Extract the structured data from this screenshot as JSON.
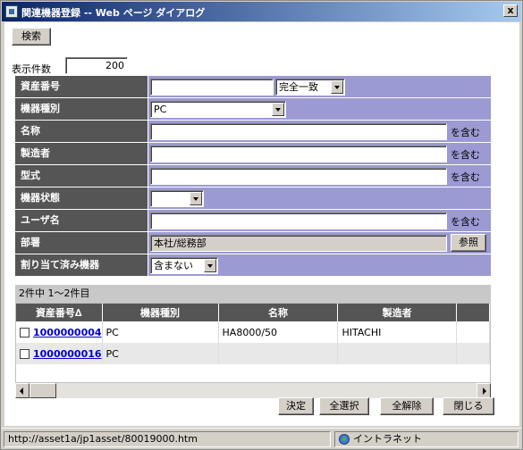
{
  "window": {
    "title": "関連機器登録 -- Web ページ ダイアログ",
    "close": "x"
  },
  "search_button": "検索",
  "display_count": {
    "label": "表示件数",
    "value": "200"
  },
  "fields": {
    "asset_no": {
      "label": "資産番号",
      "value": "",
      "match": "完全一致"
    },
    "device_type": {
      "label": "機器種別",
      "value": "PC"
    },
    "name": {
      "label": "名称",
      "value": "",
      "suffix": "を含む"
    },
    "maker": {
      "label": "製造者",
      "value": "",
      "suffix": "を含む"
    },
    "model": {
      "label": "型式",
      "value": "",
      "suffix": "を含む"
    },
    "device_state": {
      "label": "機器状態",
      "value": ""
    },
    "user_name": {
      "label": "ユーザ名",
      "value": "",
      "suffix": "を含む"
    },
    "department": {
      "label": "部署",
      "value": "本社/総務部",
      "ref_button": "参照"
    },
    "assigned": {
      "label": "割り当て済み機器",
      "value": "含まない"
    }
  },
  "result_count": "2件中 1～2件目",
  "table": {
    "columns": [
      "資産番号∆",
      "機器種別",
      "名称",
      "製造者",
      ""
    ],
    "rows": [
      {
        "asset_no": "1000000004",
        "type": "PC",
        "name": "HA8000/50",
        "maker": "HITACHI"
      },
      {
        "asset_no": "1000000016",
        "type": "PC",
        "name": "",
        "maker": ""
      }
    ]
  },
  "buttons": {
    "ok": "決定",
    "select_all": "全選択",
    "clear_all": "全解除",
    "close": "閉じる"
  },
  "status": {
    "url": "http://asset1a/jp1asset/80019000.htm",
    "zone": "イントラネット"
  }
}
